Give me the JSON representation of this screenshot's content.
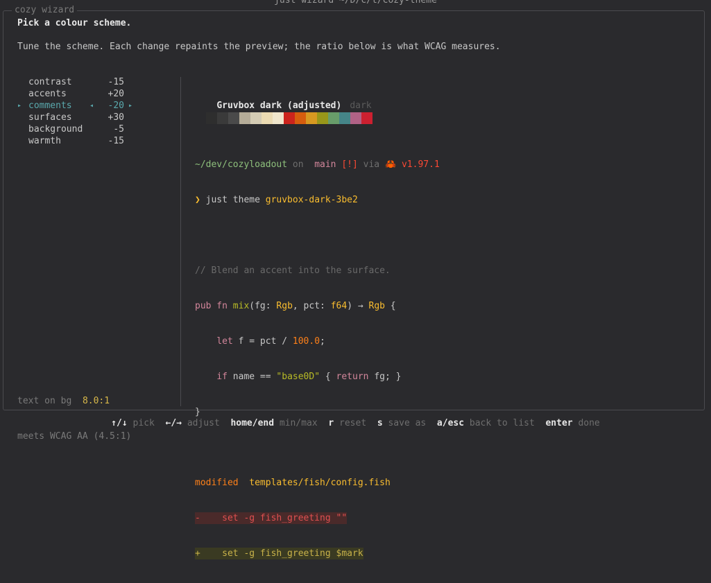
{
  "terminal_title": "just wizard ~/D/c/t/cozy-theme",
  "frame_label": "cozy wizard",
  "heading": "Pick a colour scheme.",
  "description": "Tune the scheme. Each change repaints the preview; the ratio below is what WCAG measures.",
  "adjustments": [
    {
      "name": "contrast",
      "value": "-15"
    },
    {
      "name": "accents",
      "value": "+20"
    },
    {
      "name": "comments",
      "value": "-20",
      "selected": true
    },
    {
      "name": "surfaces",
      "value": "+30"
    },
    {
      "name": "background",
      "value": "-5"
    },
    {
      "name": "warmth",
      "value": "-15"
    }
  ],
  "ratio": {
    "label": "text on bg",
    "value": "8.0:1",
    "verdict": "meets WCAG AA (4.5:1)"
  },
  "preview": {
    "title": "Gruvbox dark (adjusted)",
    "variant": "dark",
    "swatches": [
      "#2e2e2e",
      "#3a3a3a",
      "#4a4a4a",
      "#b5ac98",
      "#d4ccb4",
      "#ebdbb2",
      "#f0e6cc",
      "#cc241d",
      "#d65d0e",
      "#d79921",
      "#98971a",
      "#689d6a",
      "#458588",
      "#b16286",
      "#cc2030"
    ]
  },
  "prompt": {
    "path": "~/dev/cozyloadout",
    "on": " on ",
    "branch_icon": " ",
    "branch": "main",
    "status": " [!]",
    "via": " via ",
    "rust_icon": "🦀",
    "version": " v1.97.1",
    "caret": "❯ ",
    "cmd": "just theme ",
    "arg": "gruvbox-dark-3be2"
  },
  "code": {
    "comment": "// Blend an accent into the surface.",
    "l1_kw": "pub fn ",
    "l1_fn": "mix",
    "l1_a": "(fg: ",
    "l1_t1": "Rgb",
    "l1_b": ", pct: ",
    "l1_t2": "f64",
    "l1_c": ") → ",
    "l1_t3": "Rgb",
    "l1_d": " {",
    "l2_ind": "    ",
    "l2_kw": "let",
    "l2_a": " f = pct / ",
    "l2_num": "100.0",
    "l2_b": ";",
    "l3_ind": "    ",
    "l3_kw": "if",
    "l3_a": " name == ",
    "l3_str": "\"base0D\"",
    "l3_b": " { ",
    "l3_kw2": "return",
    "l3_c": " fg; }",
    "l4": "}"
  },
  "diff": {
    "modified": "modified",
    "file": "templates/fish/config.fish",
    "del": "-    set -g fish_greeting \"\"",
    "add": "+    set -g fish_greeting $mark"
  },
  "hints": [
    {
      "key": "↑/↓",
      "desc": "pick"
    },
    {
      "key": "←/→",
      "desc": "adjust"
    },
    {
      "key": "home/end",
      "desc": "min/max"
    },
    {
      "key": "r",
      "desc": "reset"
    },
    {
      "key": "s",
      "desc": "save as"
    },
    {
      "key": "a/esc",
      "desc": "back to list"
    },
    {
      "key": "enter",
      "desc": "done"
    }
  ]
}
